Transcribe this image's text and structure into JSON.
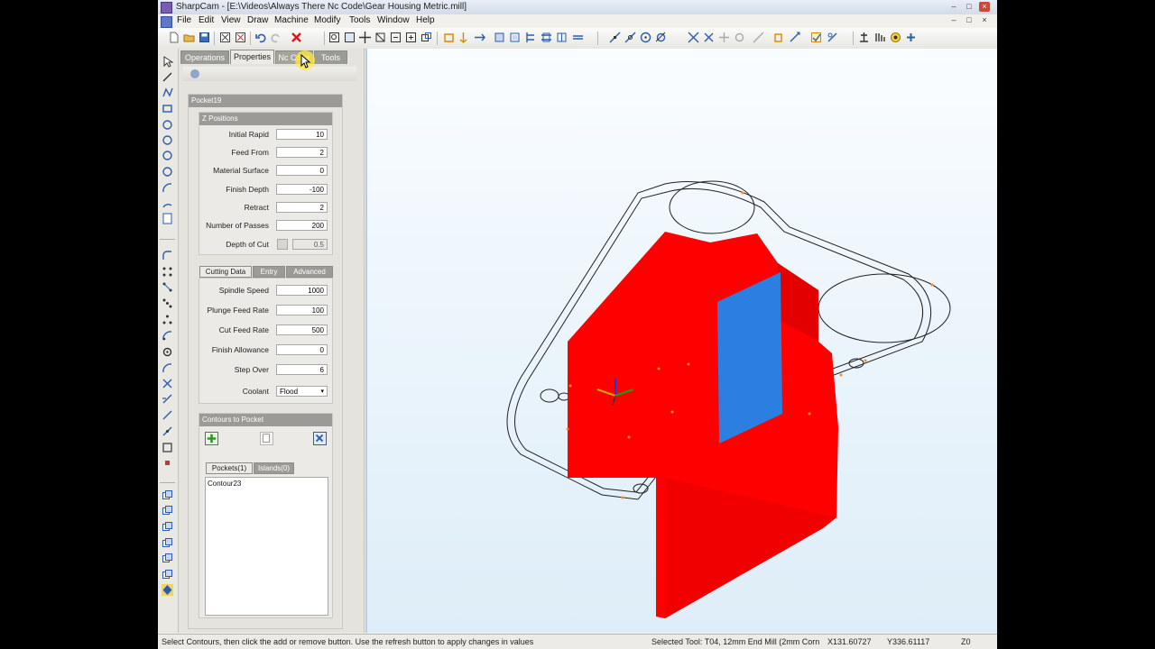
{
  "window": {
    "title": "SharpCam - [E:\\Videos\\Always There Nc Code\\Gear Housing Metric.mill]",
    "controls": [
      "–",
      "□",
      "×"
    ],
    "mdi_controls": [
      "–",
      "□",
      "×"
    ]
  },
  "menu": {
    "items": [
      {
        "label": "File"
      },
      {
        "label": "Edit"
      },
      {
        "label": "View"
      },
      {
        "label": "Draw"
      },
      {
        "label": "Machine"
      },
      {
        "label": "Modify"
      },
      {
        "label": "Tools"
      },
      {
        "label": "Window"
      },
      {
        "label": "Help"
      }
    ]
  },
  "panel": {
    "tabs": [
      {
        "label": "Operations"
      },
      {
        "label": "Properties"
      },
      {
        "label": "Nc Code"
      },
      {
        "label": "Tools"
      }
    ],
    "operation_name": "Pocket19",
    "z_positions": {
      "title": "Z Positions",
      "fields": [
        {
          "label": "Initial Rapid",
          "value": "10"
        },
        {
          "label": "Feed From",
          "value": "2"
        },
        {
          "label": "Material Surface",
          "value": "0"
        },
        {
          "label": "Finish Depth",
          "value": "-100"
        },
        {
          "label": "Retract",
          "value": "2"
        },
        {
          "label": "Number of Passes",
          "value": "200"
        },
        {
          "label": "Depth of Cut",
          "value": "0.5"
        }
      ]
    },
    "cutting": {
      "tabs": [
        {
          "label": "Cutting Data"
        },
        {
          "label": "Entry"
        },
        {
          "label": "Advanced"
        }
      ],
      "fields": [
        {
          "label": "Spindle Speed",
          "value": "1000"
        },
        {
          "label": "Plunge Feed Rate",
          "value": "100"
        },
        {
          "label": "Cut Feed Rate",
          "value": "500"
        },
        {
          "label": "Finish Allowance",
          "value": "0"
        },
        {
          "label": "Step Over",
          "value": "6"
        }
      ],
      "coolant_label": "Coolant",
      "coolant_value": "Flood"
    },
    "contours": {
      "title": "Contours to Pocket",
      "tabs": [
        {
          "label": "Pockets(1)"
        },
        {
          "label": "Islands(0)"
        }
      ],
      "items": [
        "Contour23"
      ]
    }
  },
  "status": {
    "hint": "Select Contours, then click the add or remove button. Use the refresh button to apply changes in values",
    "tool": "Selected Tool: T04, 12mm End Mill (2mm Corn",
    "x": "X131.60727",
    "y": "Y336.61117",
    "z": "Z0"
  },
  "colors": {
    "stock": "#ff0000",
    "wall": "#2b7fe0",
    "viewport_top": "#fafdff",
    "viewport_bottom": "#deedf8",
    "panel_header": "#9b9a96"
  }
}
